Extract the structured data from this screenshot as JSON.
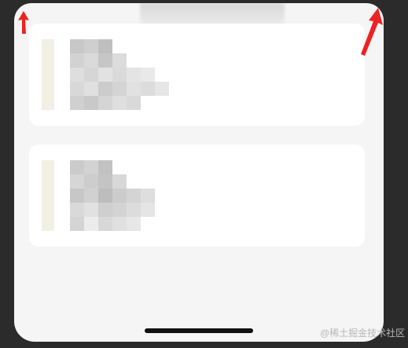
{
  "colors": {
    "outer_background": "#2b2b2b",
    "screen_background": "#f5f5f5",
    "card_background": "#ffffff",
    "card_stripe": "#f4efe3",
    "annotation_arrow": "#ee2222",
    "home_indicator": "#111111"
  },
  "cards": [
    {
      "content": "pixelated-redacted"
    },
    {
      "content": "pixelated-redacted"
    }
  ],
  "watermark": {
    "text": "@稀土掘金技术社区"
  }
}
